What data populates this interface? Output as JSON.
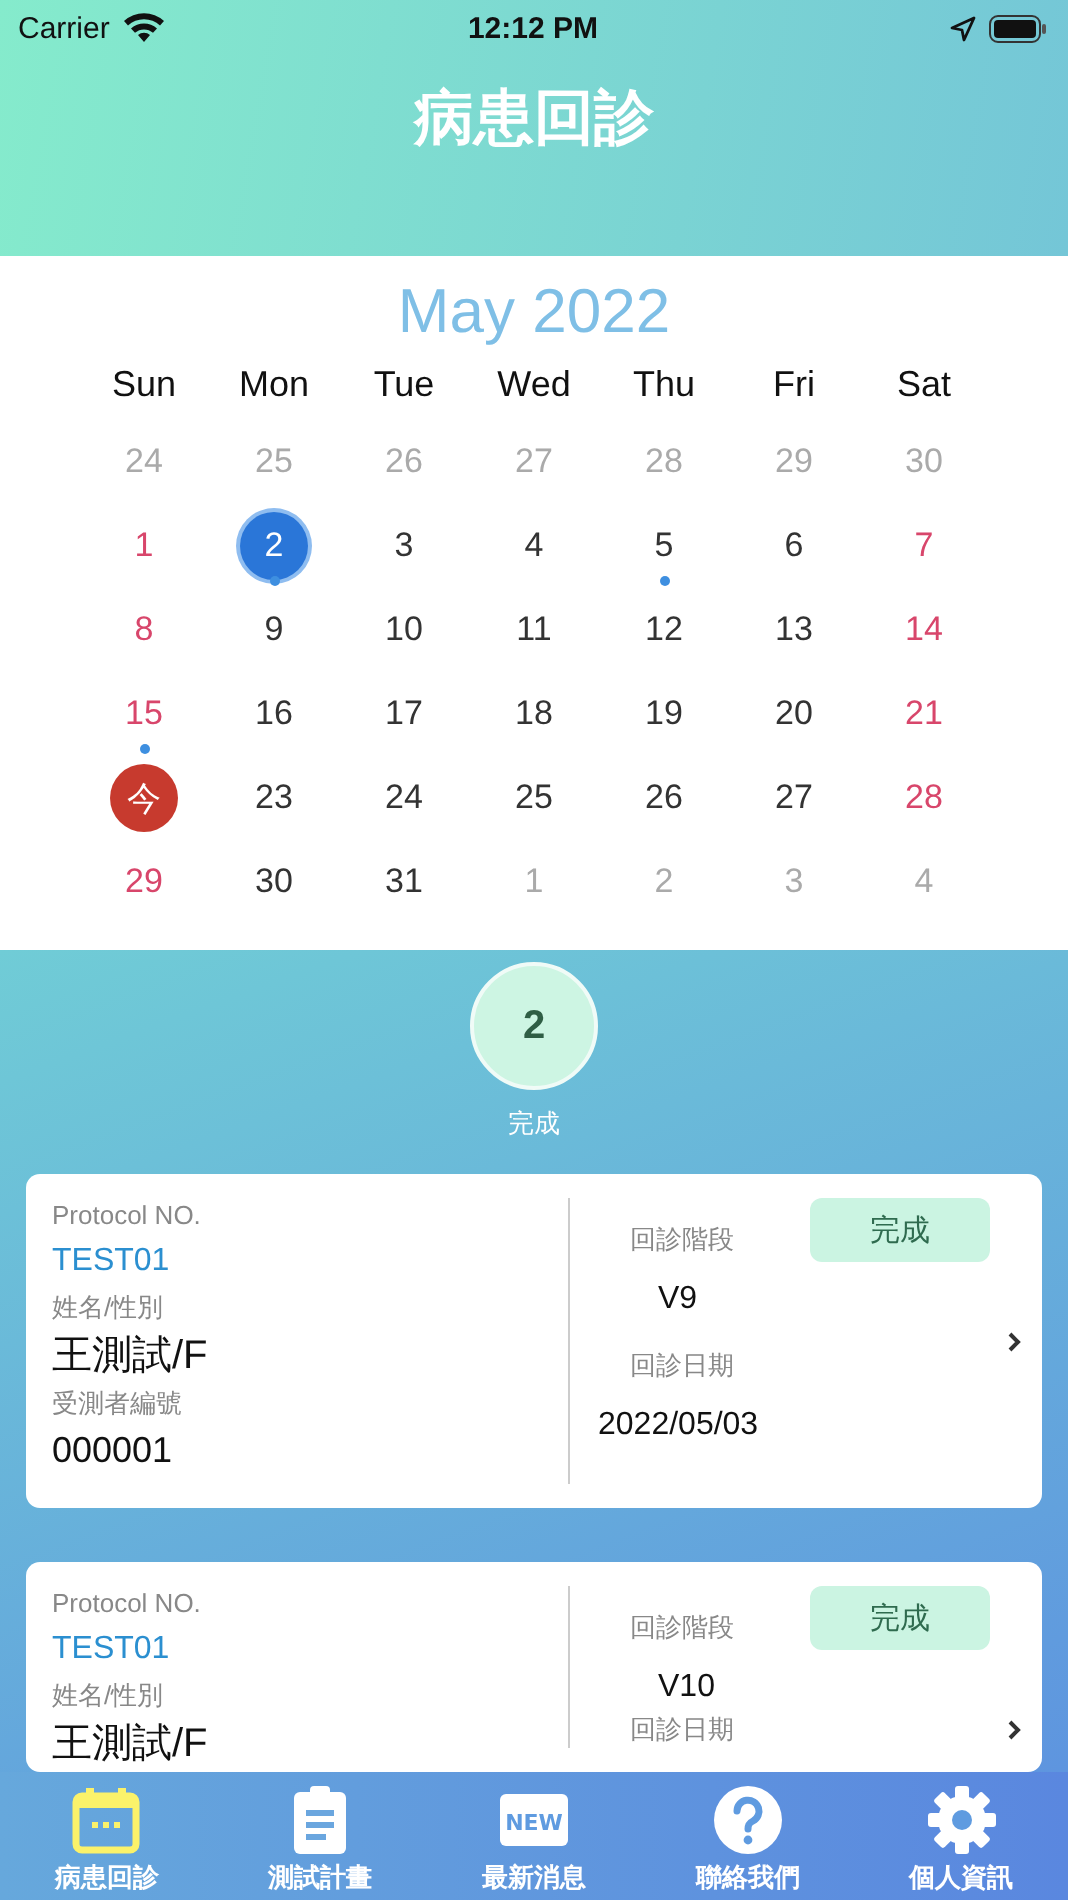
{
  "status_bar": {
    "carrier": "Carrier",
    "time": "12:12 PM"
  },
  "header": {
    "title": "病患回診"
  },
  "calendar": {
    "month_title": "May 2022",
    "weekdays": [
      "Sun",
      "Mon",
      "Tue",
      "Wed",
      "Thu",
      "Fri",
      "Sat"
    ],
    "days": [
      {
        "label": "24",
        "kind": "other",
        "event": false
      },
      {
        "label": "25",
        "kind": "other",
        "event": false
      },
      {
        "label": "26",
        "kind": "other",
        "event": false
      },
      {
        "label": "27",
        "kind": "other",
        "event": false
      },
      {
        "label": "28",
        "kind": "other",
        "event": false
      },
      {
        "label": "29",
        "kind": "other",
        "event": false
      },
      {
        "label": "30",
        "kind": "other",
        "event": false
      },
      {
        "label": "1",
        "kind": "weekend",
        "event": false
      },
      {
        "label": "2",
        "kind": "selected",
        "event": true
      },
      {
        "label": "3",
        "kind": "normal",
        "event": false
      },
      {
        "label": "4",
        "kind": "normal",
        "event": false
      },
      {
        "label": "5",
        "kind": "normal",
        "event": true
      },
      {
        "label": "6",
        "kind": "normal",
        "event": false
      },
      {
        "label": "7",
        "kind": "weekend",
        "event": false
      },
      {
        "label": "8",
        "kind": "weekend",
        "event": false
      },
      {
        "label": "9",
        "kind": "normal",
        "event": false
      },
      {
        "label": "10",
        "kind": "normal",
        "event": false
      },
      {
        "label": "11",
        "kind": "normal",
        "event": false
      },
      {
        "label": "12",
        "kind": "normal",
        "event": false
      },
      {
        "label": "13",
        "kind": "normal",
        "event": false
      },
      {
        "label": "14",
        "kind": "weekend",
        "event": false
      },
      {
        "label": "15",
        "kind": "weekend",
        "event": true
      },
      {
        "label": "16",
        "kind": "normal",
        "event": false
      },
      {
        "label": "17",
        "kind": "normal",
        "event": false
      },
      {
        "label": "18",
        "kind": "normal",
        "event": false
      },
      {
        "label": "19",
        "kind": "normal",
        "event": false
      },
      {
        "label": "20",
        "kind": "normal",
        "event": false
      },
      {
        "label": "21",
        "kind": "weekend",
        "event": false
      },
      {
        "label": "今",
        "kind": "today",
        "event": false
      },
      {
        "label": "23",
        "kind": "normal",
        "event": false
      },
      {
        "label": "24",
        "kind": "normal",
        "event": false
      },
      {
        "label": "25",
        "kind": "normal",
        "event": false
      },
      {
        "label": "26",
        "kind": "normal",
        "event": false
      },
      {
        "label": "27",
        "kind": "normal",
        "event": false
      },
      {
        "label": "28",
        "kind": "weekend",
        "event": false
      },
      {
        "label": "29",
        "kind": "weekend",
        "event": false
      },
      {
        "label": "30",
        "kind": "normal",
        "event": false
      },
      {
        "label": "31",
        "kind": "normal",
        "event": false
      },
      {
        "label": "1",
        "kind": "other",
        "event": false
      },
      {
        "label": "2",
        "kind": "other",
        "event": false
      },
      {
        "label": "3",
        "kind": "other",
        "event": false
      },
      {
        "label": "4",
        "kind": "other",
        "event": false
      }
    ]
  },
  "summary": {
    "count": "2",
    "label": "完成"
  },
  "visits": [
    {
      "protocol_label": "Protocol NO.",
      "protocol": "TEST01",
      "name_label": "姓名/性別",
      "name": "王測試/F",
      "id_label": "受測者編號",
      "id": "000001",
      "stage_label": "回診階段",
      "stage": "V9",
      "date_label": "回診日期",
      "date": "2022/05/03",
      "status": "完成"
    },
    {
      "protocol_label": "Protocol NO.",
      "protocol": "TEST01",
      "name_label": "姓名/性別",
      "name": "王測試/F",
      "stage_label": "回診階段",
      "stage": "V10",
      "date_label": "回診日期",
      "status": "完成"
    }
  ],
  "tab_bar": [
    {
      "label": "病患回診",
      "kind": "calendar",
      "selected": true
    },
    {
      "label": "測試計畫",
      "kind": "clipboard",
      "selected": false
    },
    {
      "label": "最新消息",
      "kind": "news",
      "icon_text": "NEW",
      "selected": false
    },
    {
      "label": "聯絡我們",
      "kind": "help",
      "selected": false
    },
    {
      "label": "個人資訊",
      "kind": "settings",
      "selected": false
    }
  ]
}
